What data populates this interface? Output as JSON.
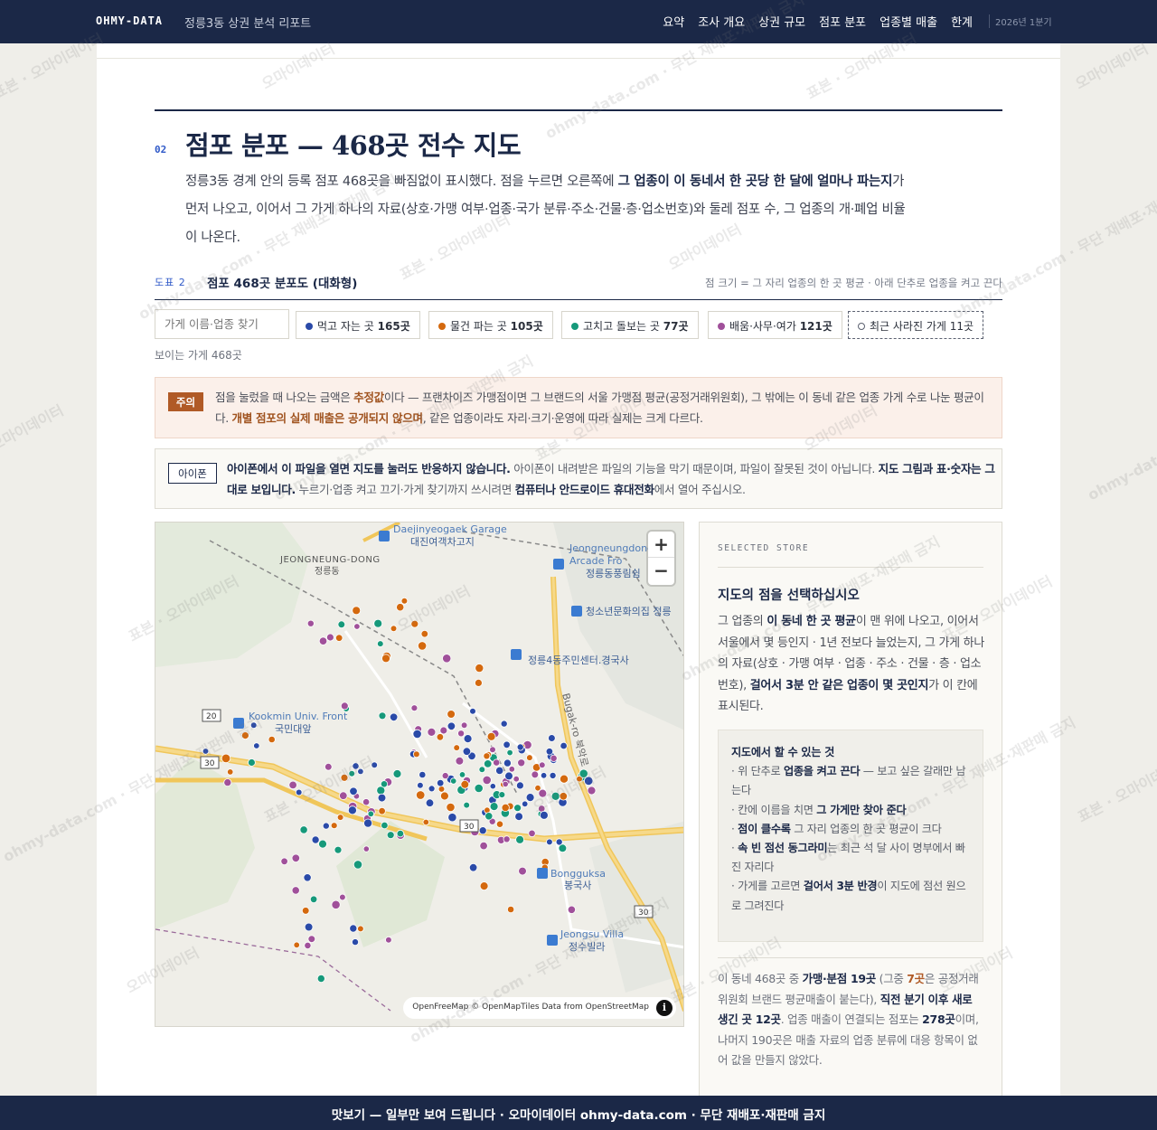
{
  "header": {
    "brand": "OHMY-DATA",
    "report_title": "정릉3동 상권 분석 리포트",
    "nav": [
      "요약",
      "조사 개요",
      "상권 규모",
      "점포 분포",
      "업종별 매출",
      "한계"
    ],
    "period": "2026년 1분기"
  },
  "section": {
    "number": "02",
    "title": "점포 분포 — 468곳 전수 지도",
    "lede": {
      "p1": "정릉3동 경계 안의 등록 점포 468곳을 빠짐없이 표시했다. 점을 누르면 오른쪽에 ",
      "b1": "그 업종이 이 동네서 한 곳당 한 달에 얼마나 파는지",
      "p2": "가 먼저 나오고, 이어서 그 가게 하나의 자료(상호·가맹 여부·업종·국가 분류·주소·건물·층·업소번호)와 둘레 점포 수, 그 업종의 개·폐업 비율이 나온다."
    }
  },
  "figure": {
    "label": "도표 2",
    "title": "점포 468곳 분포도 (대화형)",
    "note": "점 크기 = 그 자리 업종의 한 곳 평균 · 아래 단추로 업종을 켜고 끈다",
    "search_placeholder": "가게 이름·업종 찾기",
    "chips": [
      {
        "label": "먹고 자는 곳",
        "count": "165곳",
        "color": "#2a4aa8"
      },
      {
        "label": "물건 파는 곳",
        "count": "105곳",
        "color": "#d4690e"
      },
      {
        "label": "고치고 돌보는 곳",
        "count": "77곳",
        "color": "#16997a"
      },
      {
        "label": "배움·사무·여가",
        "count": "121곳",
        "color": "#a0509a"
      }
    ],
    "closed_chip": "최근 사라진 가게 11곳",
    "visible_count": "보이는 가게 468곳"
  },
  "caution": {
    "tag": "주의",
    "t1": "점을 눌렀을 때 나오는 금액은 ",
    "h1": "추정값",
    "t2": "이다 — 프랜차이즈 가맹점이면 그 브랜드의 서울 가맹점 평균(공정거래위원회), 그 밖에는 이 동네 같은 업종 가게 수로 나눈 평균이다. ",
    "h2": "개별 점포의 실제 매출은 공개되지 않으며",
    "t3": ", 같은 업종이라도 자리·크기·운영에 따라 실제는 크게 다르다."
  },
  "iphone": {
    "tag": "아이폰",
    "b1": "아이폰에서 이 파일을 열면 지도를 눌러도 반응하지 않습니다.",
    "t1": " 아이폰이 내려받은 파일의 기능을 막기 때문이며, 파일이 잘못된 것이 아닙니다. ",
    "b2": "지도 그림과 표·숫자는 그대로 보입니다.",
    "t2": " 누르기·업종 켜고 끄기·가게 찾기까지 쓰시려면 ",
    "b3": "컴퓨터나 안드로이드 휴대전화",
    "t3": "에서 열어 주십시오."
  },
  "map": {
    "labels": {
      "daejin_en": "Daejinyeogaek Garage",
      "daejin_ko": "대진여객차고지",
      "jeongneung_en": "JEONGNEUNG-DONG",
      "jeongneung_ko": "정릉동",
      "arcade_en": "Jeongneungdong",
      "arcade_en2": "Arcade Fro",
      "arcade_ko": "정릉동풍림쉼",
      "youth": "청소년문화의집 정릉",
      "community": "정릉4동주민센터.경국사",
      "kookmin_en": "Kookmin Univ. Front",
      "kookmin_ko": "국민대앞",
      "bugak": "Bugak-ro 북악로",
      "bonggu_en": "Bongguksa",
      "bonggu_ko": "봉국사",
      "jeongsu_en": "Jeongsu Villa",
      "jeongsu_ko": "정수빌라",
      "road20": "20",
      "road30": "30"
    },
    "zoom_in": "+",
    "zoom_out": "−",
    "attribution": "OpenFreeMap © OpenMapTiles Data from OpenStreetMap",
    "info": "i"
  },
  "panel": {
    "kicker": "SELECTED STORE",
    "title": "지도의 점을 선택하십시오",
    "body": {
      "t1": "그 업종의 ",
      "b1": "이 동네 한 곳 평균",
      "t2": "이 맨 위에 나오고, 이어서 서울에서 몇 등인지 · 1년 전보다 늘었는지, 그 가게 하나의 자료(상호 · 가맹 여부 · 업종 · 주소 · 건물 · 층 · 업소번호), ",
      "b2": "걸어서 3분 안 같은 업종이 몇 곳인지",
      "t3": "가 이 칸에 표시된다."
    },
    "howto": {
      "title": "지도에서 할 수 있는 것",
      "i1a": "· 위 단추로 ",
      "i1b": "업종을 켜고 끈다",
      "i1c": " — 보고 싶은 갈래만 남는다",
      "i2a": "· 칸에 이름을 치면 ",
      "i2b": "그 가게만 찾아 준다",
      "i2c": "",
      "i3a": "· ",
      "i3b": "점이 클수록",
      "i3c": " 그 자리 업종의 한 곳 평균이 크다",
      "i4a": "· ",
      "i4b": "속 빈 점선 동그라미",
      "i4c": "는 최근 석 달 사이 명부에서 빠진 자리다",
      "i5a": "· 가게를 고르면 ",
      "i5b": "걸어서 3분 반경",
      "i5c": "이 지도에 점선 원으로 그려진다"
    },
    "stats": {
      "t1": "이 동네 468곳 중 ",
      "b1": "가맹·분점 19곳",
      "t2": " (그중 ",
      "o1": "7곳",
      "t3": "은 공정거래위원회 브랜드 평균매출이 붙는다), ",
      "b2": "직전 분기 이후 새로 생긴 곳 12곳",
      "t4": ". 업종 매출이 연결되는 점포는 ",
      "b3": "278곳",
      "t5": "이며, 나머지 190곳은 매출 자료의 업종 분류에 대응 항목이 없어 값을 만들지 않았다."
    }
  },
  "footer": "맛보기 — 일부만 보여 드립니다 · 오마이데이터 ohmy-data.com · 무단 재배포·재판매 금지",
  "watermark": [
    "표본 · 오마이데이터",
    "오마이데이터",
    "ohmy-data.com · 무단 재배포·재판매 금지"
  ]
}
